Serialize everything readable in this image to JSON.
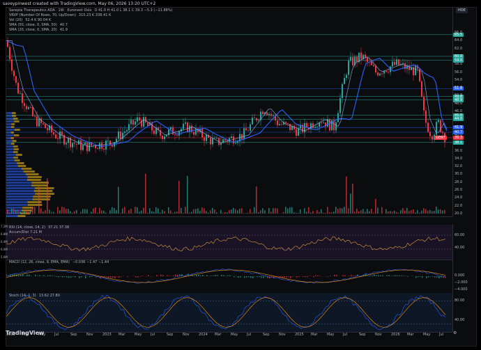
{
  "caption": "saveypinwest created with TradingView.com, May 06, 2026 13:20 UTC+2",
  "brand": "TradingView",
  "settings_glyph": "⚙",
  "timeframe_badge": "HOE",
  "legend": {
    "symbol": "Sarepta Therapeutics ADA · 1W · Euronext Oslo",
    "ohlc": "O 41.0  H 41.0  L 38.1  C 39.3  −5.3 (−11.88%)",
    "vrvp": "VRVP (Number Of Rows, 70, Up/Down)",
    "vrvp_values": "315.23 K  338.41 K",
    "vol": "Vol (20)",
    "vol_values": "52.4 K  90.04 K",
    "sma50": "SMA (50, close, 0, SMA, 50)",
    "sma50_value": "40.7",
    "sma20": "SMA (20, close, 0, SMA, 20)",
    "sma20_value": "41.9"
  },
  "price_ticks": [
    "66.0",
    "64.0",
    "62.0",
    "60.0",
    "58.0",
    "56.0",
    "54.0",
    "52.0",
    "50.0",
    "48.0",
    "46.0",
    "44.0",
    "42.0",
    "40.0",
    "38.0",
    "36.0",
    "34.0",
    "32.0",
    "30.0",
    "28.0",
    "26.0",
    "24.0",
    "22.0",
    "20.0"
  ],
  "price_tags": [
    {
      "label": "65.5",
      "color": "#26a69a",
      "value": 65.5
    },
    {
      "label": "60.0",
      "color": "#26a69a",
      "value": 60.0
    },
    {
      "label": "59.0",
      "color": "#26a69a",
      "value": 59.0
    },
    {
      "label": "51.8",
      "color": "#2962ff",
      "value": 51.8
    },
    {
      "label": "49.8",
      "color": "#26a69a",
      "value": 49.8
    },
    {
      "label": "48.9",
      "color": "#26a69a",
      "value": 48.9
    },
    {
      "label": "45.0",
      "color": "#26a69a",
      "value": 45.0
    },
    {
      "label": "44.0",
      "color": "#26a69a",
      "value": 44.0
    },
    {
      "label": "41.9",
      "color": "#2962ff",
      "value": 41.9
    },
    {
      "label": "40.7",
      "color": "#2962ff",
      "value": 40.7
    },
    {
      "label": "39.3",
      "color": "#f23645",
      "value": 39.3
    },
    {
      "label": "38.1",
      "color": "#26a69a",
      "value": 38.1
    }
  ],
  "last_price_label": "GENT",
  "time_labels": [
    "2022",
    "Mar",
    "May",
    "Jul",
    "Sep",
    "Nov",
    "2023",
    "Mar",
    "May",
    "Jul",
    "Sep",
    "Nov",
    "2024",
    "Mar",
    "May",
    "Jul",
    "Sep",
    "Nov",
    "2025",
    "Mar",
    "May",
    "Jul",
    "Sep",
    "Nov",
    "2026",
    "Mar",
    "May",
    "Jul"
  ],
  "rsi": {
    "label": "RSI (14, close, 14, 2)",
    "values": "37.21  37.38",
    "accum_label": "Accum/Dist  7.21 M",
    "ticks": [
      "7.2M",
      "6.8M",
      "6.4M",
      "6.0M",
      "5.6M"
    ],
    "right_ticks": [
      "60.00",
      "40.00"
    ]
  },
  "macd": {
    "label": "MACD (12, 26, close, 9, EMA, EMA)",
    "values": "−0.036  −1.47  −1.44",
    "ticks": [
      "0.000",
      "−2.000",
      "−4.000"
    ]
  },
  "stoch": {
    "label": "Stoch (14, 1, 3)",
    "values": "13.62  27.80",
    "ticks": [
      "80.00",
      "40.00"
    ]
  },
  "colors": {
    "up": "#26a69a",
    "down": "#f23645",
    "sma50": "#2962ff",
    "sma20": "#8fb3e8",
    "rsi": "#e0a040",
    "macd": "#2962ff",
    "signal": "#ff9800",
    "stochK": "#2962ff",
    "stochD": "#ff9800",
    "hline": "#26a69a",
    "hline_blue": "#2962ff"
  }
}
